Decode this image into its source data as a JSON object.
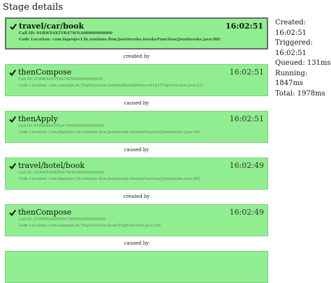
{
  "page_title": "Stage details",
  "stages": [
    {
      "name": "travel/car/book",
      "time": "16:02:51",
      "call_id": "Call ID: 01BWX4XTYB47WNA00000000000",
      "code_location": "Code Location: com.fnproject.fn.runtime.flow.JsonInvoke.invokeFunction(JsonInvoke.java:80)",
      "selected": true
    },
    {
      "name": "thenCompose",
      "time": "16:02:51",
      "call_id": "Call ID: 01BWX4XTY847WN000000000000",
      "code_location": "Code Location: com.example.fn.TripFunction.lambda$book$46eece91$1(TripFunction.java:21)"
    },
    {
      "name": "thenApply",
      "time": "16:02:51",
      "call_id": "Call ID: 01BWX4XTEQ47WN000000000000",
      "code_location": "Code Location: com.fnproject.fn.runtime.flow.JsonInvoke.invokeFunction(JsonInvoke.java:48)"
    },
    {
      "name": "travel/hotel/book",
      "time": "16:02:49",
      "call_id": "Call ID: 01BWX4XBTN47WN200000000000",
      "code_location": "Code Location: com.fnproject.fn.runtime.flow.JsonInvoke.invokeFunction(JsonInvoke.java:80)"
    },
    {
      "name": "thenCompose",
      "time": "16:02:49",
      "call_id": "Call ID: 01BWX4XBNM47WN000000000000",
      "code_location": "Code Location: com.example.fn.TripFunction.book(TripFunction.java:19)"
    }
  ],
  "connectors": [
    "created by",
    "caused by",
    "caused by",
    "created by",
    "caused by"
  ],
  "stats": {
    "created": "Created: 16:02:51",
    "triggered": "Triggered: 16:02:51",
    "queued": "Queued: 131ms",
    "running": "Running: 1847ms",
    "total": "Total: 1978ms"
  },
  "colors": {
    "card_bg": "#90ee90",
    "selected_border": "#6a6a6a"
  },
  "icons": {
    "status": "checkmark-icon"
  }
}
